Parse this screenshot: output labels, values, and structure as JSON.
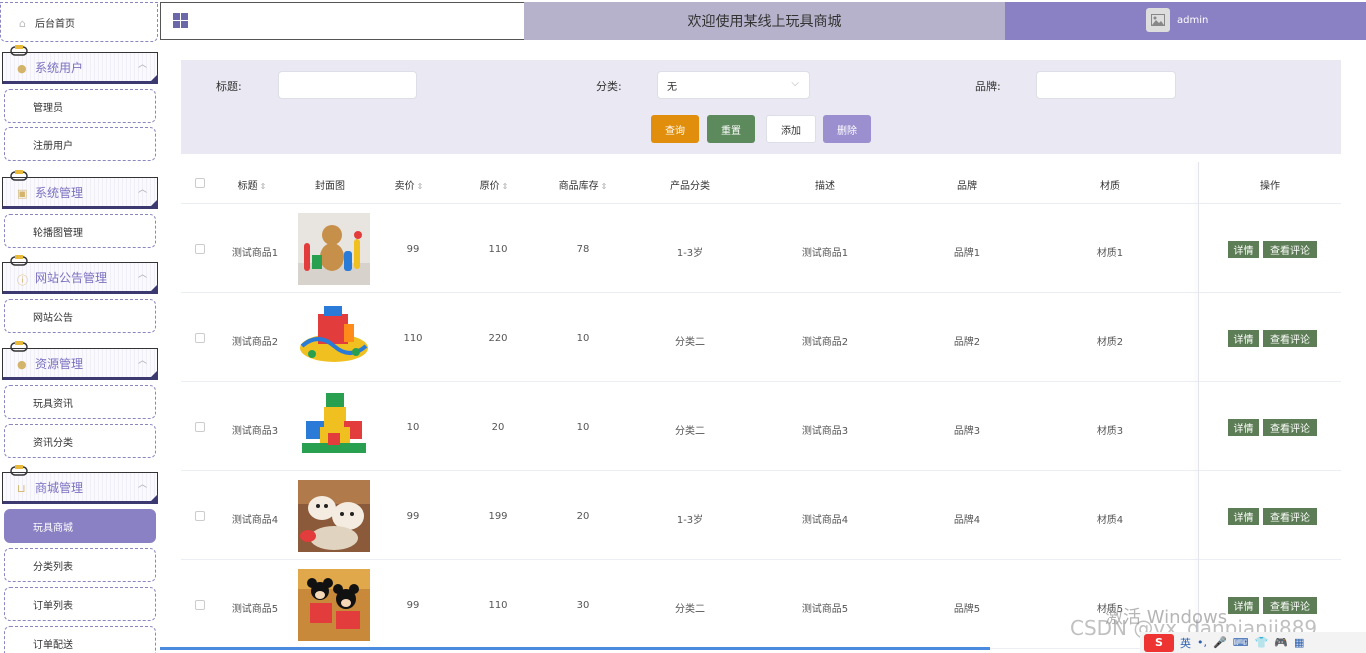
{
  "header": {
    "title": "欢迎使用某线上玩具商城",
    "username": "admin"
  },
  "sidebar": {
    "home": "后台首页",
    "groups": [
      {
        "title": "系统用户",
        "items": [
          "管理员",
          "注册用户"
        ]
      },
      {
        "title": "系统管理",
        "items": [
          "轮播图管理"
        ]
      },
      {
        "title": "网站公告管理",
        "items": [
          "网站公告"
        ]
      },
      {
        "title": "资源管理",
        "items": [
          "玩具资讯",
          "资讯分类"
        ]
      },
      {
        "title": "商城管理",
        "items": [
          "玩具商城",
          "分类列表",
          "订单列表",
          "订单配送"
        ]
      }
    ]
  },
  "search": {
    "title_label": "标题:",
    "category_label": "分类:",
    "category_value": "无",
    "brand_label": "品牌:",
    "query_btn": "查询",
    "reset_btn": "重置",
    "add_btn": "添加",
    "delete_btn": "删除"
  },
  "table": {
    "columns": [
      "标题",
      "封面图",
      "卖价",
      "原价",
      "商品库存",
      "产品分类",
      "描述",
      "品牌",
      "材质",
      "操作"
    ],
    "rows": [
      {
        "title": "测试商品1",
        "price": "99",
        "orig": "110",
        "stock": "78",
        "category": "1-3岁",
        "desc": "测试商品1",
        "brand": "品牌1",
        "material": "材质1"
      },
      {
        "title": "测试商品2",
        "price": "110",
        "orig": "220",
        "stock": "10",
        "category": "分类二",
        "desc": "测试商品2",
        "brand": "品牌2",
        "material": "材质2"
      },
      {
        "title": "测试商品3",
        "price": "10",
        "orig": "20",
        "stock": "10",
        "category": "分类二",
        "desc": "测试商品3",
        "brand": "品牌3",
        "material": "材质3"
      },
      {
        "title": "测试商品4",
        "price": "99",
        "orig": "199",
        "stock": "20",
        "category": "1-3岁",
        "desc": "测试商品4",
        "brand": "品牌4",
        "material": "材质4"
      },
      {
        "title": "测试商品5",
        "price": "99",
        "orig": "110",
        "stock": "30",
        "category": "分类二",
        "desc": "测试商品5",
        "brand": "品牌5",
        "material": "材质5"
      }
    ],
    "detail_btn": "详情",
    "review_btn": "查看评论"
  },
  "overlay": {
    "watermark": "激活 Windows",
    "csdn": "CSDN @vx_danpianji889",
    "ime": "英"
  }
}
